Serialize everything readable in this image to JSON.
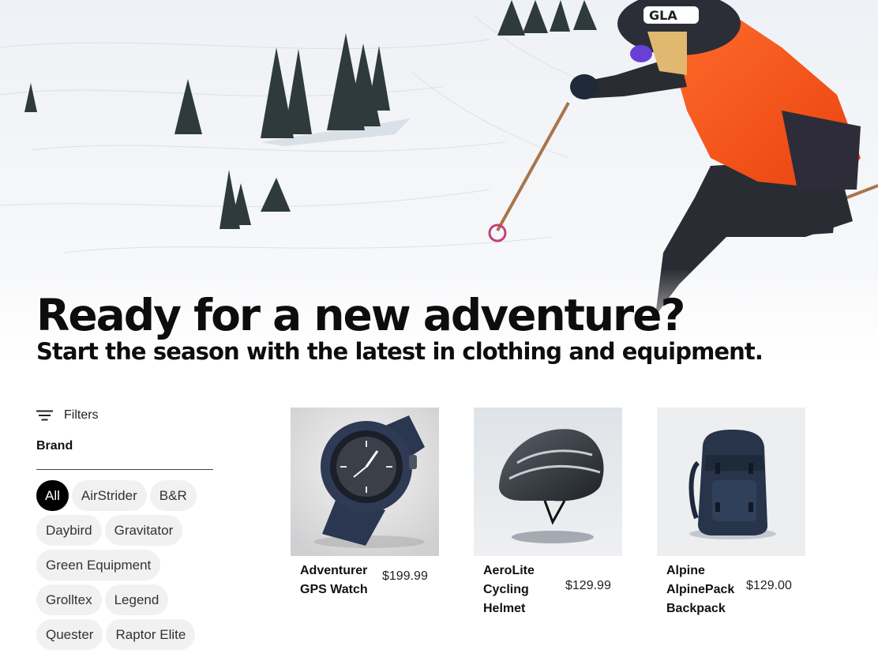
{
  "hero": {
    "title": "Ready for a new adventure?",
    "subtitle": "Start the season with the latest in clothing and equipment.",
    "helmet_brand": "GLA"
  },
  "filters": {
    "label": "Filters",
    "icon": "filter-lines-icon",
    "brand_heading": "Brand",
    "brands": [
      {
        "label": "All",
        "selected": true
      },
      {
        "label": "AirStrider",
        "selected": false
      },
      {
        "label": "B&R",
        "selected": false
      },
      {
        "label": "Daybird",
        "selected": false
      },
      {
        "label": "Gravitator",
        "selected": false
      },
      {
        "label": "Green Equipment",
        "selected": false
      },
      {
        "label": "Grolltex",
        "selected": false
      },
      {
        "label": "Legend",
        "selected": false
      },
      {
        "label": "Quester",
        "selected": false
      },
      {
        "label": "Raptor Elite",
        "selected": false
      }
    ]
  },
  "products": [
    {
      "name": "Adventurer GPS Watch",
      "price": "$199.99",
      "image": "gps-watch-image"
    },
    {
      "name": "AeroLite Cycling Helmet",
      "price": "$129.99",
      "image": "cycling-helmet-image"
    },
    {
      "name": "Alpine AlpinePack Backpack",
      "price": "$129.00",
      "image": "backpack-image"
    }
  ],
  "colors": {
    "chip_bg": "#f1f1f1",
    "chip_active_bg": "#000000",
    "jacket_orange": "#ff5a1f",
    "text": "#0d0d0d"
  }
}
